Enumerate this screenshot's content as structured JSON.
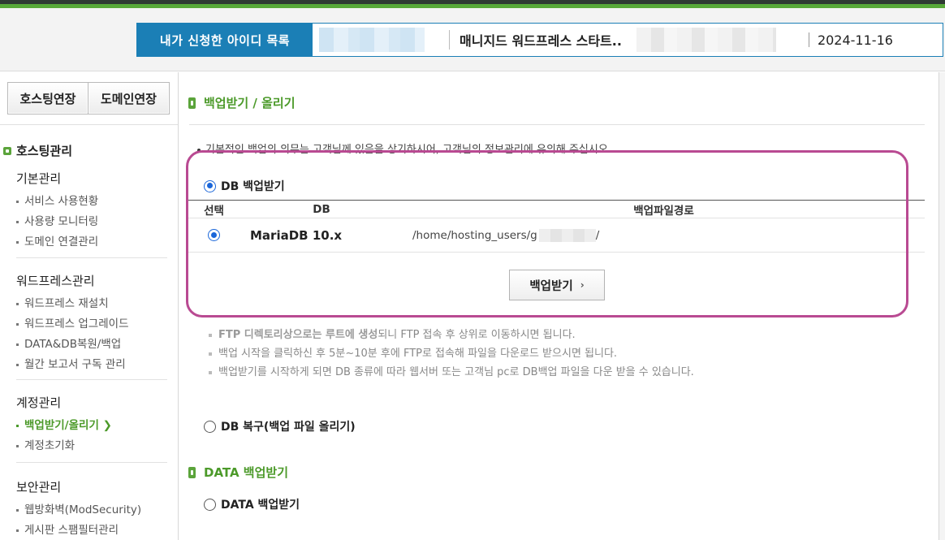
{
  "header": {
    "id_list_label": "내가 신청한 아이디 목록",
    "product_name": "매니지드 워드프레스 스타트..",
    "date": "2024-11-16"
  },
  "sidebar": {
    "buttons": [
      "호스팅연장",
      "도메인연장"
    ],
    "section_title": "호스팅관리",
    "groups": [
      {
        "title": "기본관리",
        "items": [
          "서비스 사용현황",
          "사용량 모니터링",
          "도메인 연결관리"
        ]
      },
      {
        "title": "워드프레스관리",
        "items": [
          "워드프레스 재설치",
          "워드프레스 업그레이드",
          "DATA&DB복원/백업",
          "월간 보고서 구독 관리"
        ]
      },
      {
        "title": "계정관리",
        "items": [
          "백업받기/올리기 ❯",
          "계정초기화"
        ]
      },
      {
        "title": "보안관리",
        "items": [
          "웹방화벽(ModSecurity)",
          "게시판 스팸필터관리"
        ]
      }
    ]
  },
  "main": {
    "heading": "백업받기 / 올리기",
    "notice": "기본적인 백업의 의무는 고객님께 있음을 상기하시어, 고객님의 정보관리에 유의해 주십시오.",
    "db_backup": {
      "radio_label": "DB 백업받기",
      "columns": [
        "선택",
        "DB",
        "백업파일경로"
      ],
      "row": {
        "db": "MariaDB 10.x",
        "path": "/home/hosting_users/g",
        "path_end": "/"
      },
      "button_label": "백업받기",
      "button_chevron": "›"
    },
    "info": {
      "line1_bold": "FTP 디렉토리상으로는 루트에 생성",
      "line1_rest": "되니 FTP 접속 후 상위로 이동하시면 됩니다.",
      "line2": "백업 시작을 클릭하신 후 5분~10분 후에 FTP로 접속해 파일을 다운로드 받으시면 됩니다.",
      "line3": "백업받기를 시작하게 되면 DB 종류에 따라 웹서버 또는 고객님 pc로 DB백업 파일을 다운 받을 수 있습니다."
    },
    "db_restore_label": "DB 복구(백업 파일 올리기)",
    "data_heading": "DATA 백업받기",
    "data_backup_label": "DATA 백업받기"
  },
  "colors": {
    "accent_green": "#4c9a2a",
    "id_bar_blue": "#1b7fb6",
    "highlight_magenta": "#b94a92",
    "radio_blue": "#1a66d9"
  }
}
